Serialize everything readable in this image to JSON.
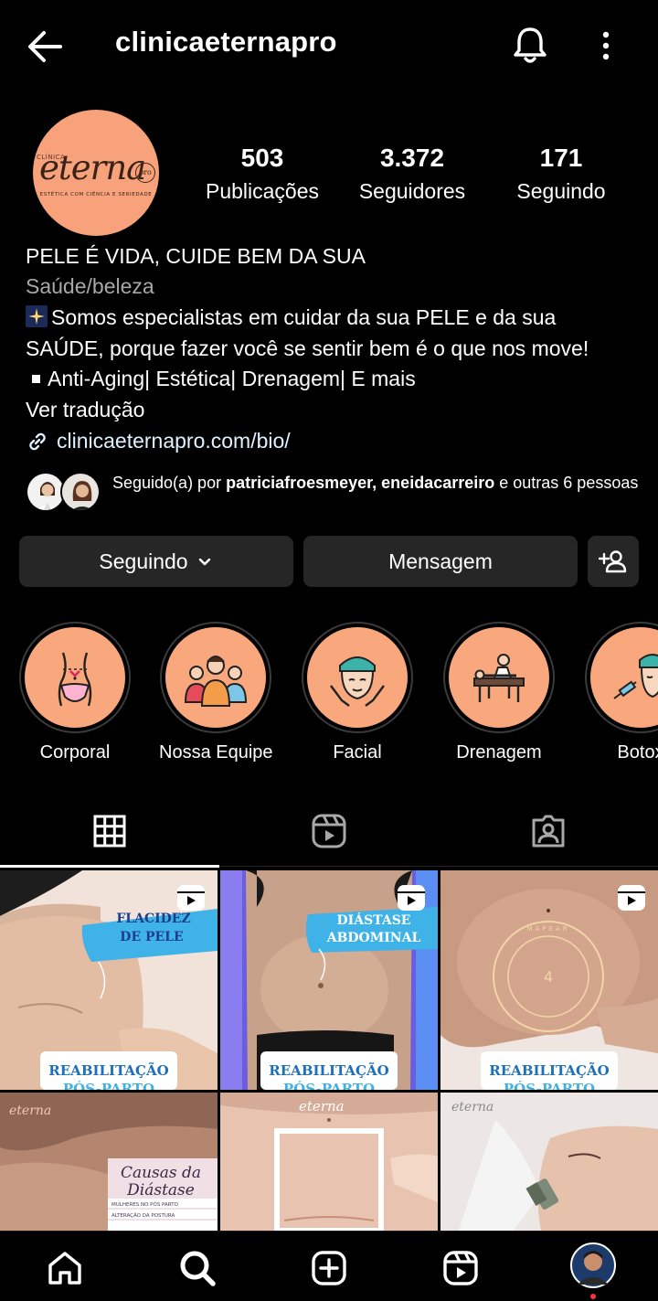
{
  "header": {
    "username": "clinicaeternapro"
  },
  "profile": {
    "logo": {
      "small_text": "CLÍNICA",
      "main_text": "eterna",
      "badge_text": "pro",
      "tagline": "ESTÉTICA COM CIÊNCIA E SERIEDADE"
    },
    "stats": [
      {
        "value": "503",
        "label": "Publicações"
      },
      {
        "value": "3.372",
        "label": "Seguidores"
      },
      {
        "value": "171",
        "label": "Seguindo"
      }
    ],
    "bio": {
      "name": "PELE É VIDA, CUIDE BEM DA SUA",
      "category": "Saúde/beleza",
      "line1": "Somos especialistas em cuidar da sua PELE e da sua",
      "line2": "SAÚDE, porque fazer você se sentir bem é o que nos move!",
      "line3": "Anti-Aging| Estética| Drenagem| E mais",
      "translate": "Ver tradução",
      "link": "clinicaeternapro.com/bio/"
    },
    "followed_by": {
      "prefix": "Seguido(a) por ",
      "users": "patriciafroesmeyer, eneidacarreiro",
      "suffix": " e outras 6 pessoas"
    }
  },
  "actions": {
    "following_label": "Seguindo",
    "message_label": "Mensagem"
  },
  "highlights": [
    {
      "label": "Corporal",
      "icon": "body-waist-icon"
    },
    {
      "label": "Nossa Equipe",
      "icon": "team-icon"
    },
    {
      "label": "Facial",
      "icon": "face-care-icon"
    },
    {
      "label": "Drenagem",
      "icon": "massage-icon"
    },
    {
      "label": "Botox",
      "icon": "injection-icon"
    }
  ],
  "tabs": [
    {
      "name": "grid-tab",
      "icon": "grid-icon",
      "active": true
    },
    {
      "name": "reels-tab",
      "icon": "reels-icon",
      "active": false
    },
    {
      "name": "tagged-tab",
      "icon": "tagged-user-icon",
      "active": false
    }
  ],
  "posts": [
    {
      "title": "FLACIDEZ\nDE PELE",
      "title_l1": "FLACIDEZ",
      "title_l2": "DE PELE",
      "footer": "REABILITAÇÃO",
      "footer2": "PÓS-PARTO",
      "reel": true
    },
    {
      "title_l1": "DIÁSTASE",
      "title_l2": "ABDOMINAL",
      "footer": "REABILITAÇÃO",
      "footer2": "PÓS-PARTO",
      "reel": true
    },
    {
      "number": "4",
      "ring_text": "MAPEAR",
      "footer": "REABILITAÇÃO",
      "footer2": "PÓS-PARTO",
      "reel": true
    },
    {
      "brand": "eterna",
      "title_l1": "Causas da",
      "title_l2": "Diástase",
      "items": [
        "MULHERES NO PÓS PARTO",
        "ALTERAÇÃO DA POSTURA",
        ""
      ]
    },
    {
      "brand": "eterna"
    },
    {
      "brand": "eterna"
    }
  ],
  "colors": {
    "background": "#000000",
    "button": "#262626",
    "highlight_fill": "#f9a77c",
    "logo_fill": "#f7a27b",
    "muted_text": "#a8a8a8",
    "link_text": "#e0f1ff",
    "post_blue": "#3fb3e8",
    "post_navy": "#1c3f8c",
    "notification_dot": "#ff3040"
  },
  "bottom_nav": [
    {
      "name": "home-icon"
    },
    {
      "name": "search-icon"
    },
    {
      "name": "create-post-icon"
    },
    {
      "name": "reels-nav-icon"
    },
    {
      "name": "profile-avatar"
    }
  ]
}
